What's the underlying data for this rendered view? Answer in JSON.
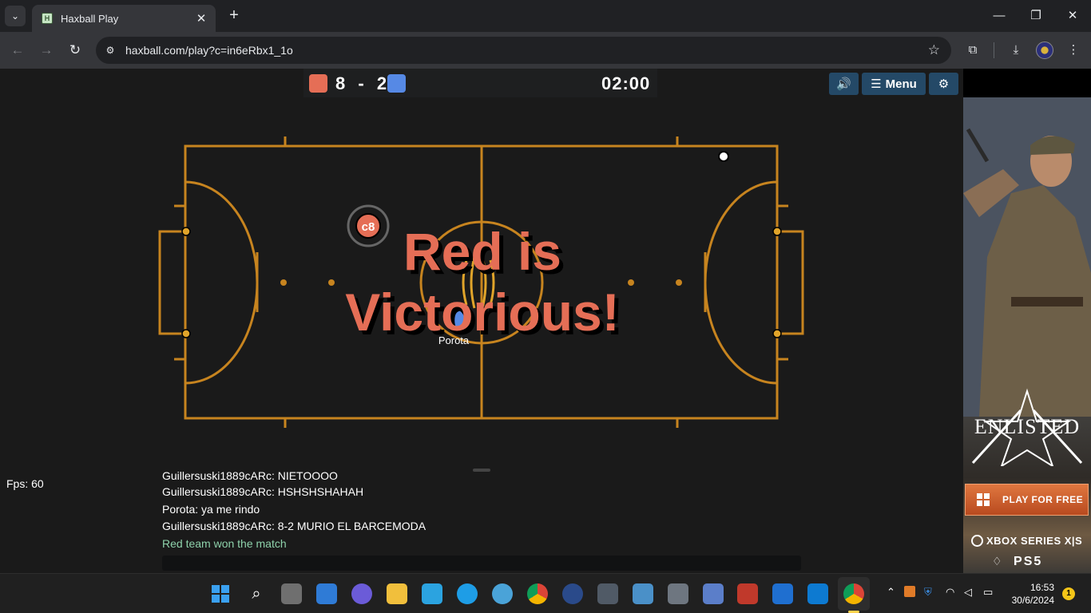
{
  "browser": {
    "tab_title": "Haxball Play",
    "favicon_letter": "H",
    "url": "haxball.com/play?c=in6eRbx1_1o"
  },
  "game": {
    "score": {
      "red": "8",
      "separator": "-",
      "blue": "2"
    },
    "timer": "02:00",
    "buttons": {
      "sound_icon": "speaker-icon",
      "menu_label": "Menu",
      "settings_icon": "gear-icon"
    },
    "victory_line1": "Red is",
    "victory_line2": "Victorious!",
    "player_avatar": "c8",
    "player_name": "Porota",
    "fps_label": "Fps: 60",
    "colors": {
      "red_team": "#e56e56",
      "blue_team": "#5689e5",
      "field_line": "#c7841f",
      "victory_text": "#e56e56"
    }
  },
  "chat": {
    "messages": [
      {
        "text": "Guillersuski1889cARc: NIETOOOO",
        "type": "user"
      },
      {
        "text": "Guillersuski1889cARc: HSHSHSHAHAH",
        "type": "user"
      },
      {
        "text": "Porota: ya me rindo",
        "type": "user"
      },
      {
        "text": "Guillersuski1889cARc: 8-2 MURIO EL BARCEMODA",
        "type": "user"
      },
      {
        "text": "Red team won the match",
        "type": "system"
      }
    ],
    "input_value": ""
  },
  "ad": {
    "brand": "ENLISTED",
    "cta": "PLAY FOR FREE",
    "platform1": "XBOX SERIES X|S",
    "platform2": "PS5"
  },
  "taskbar": {
    "time": "16:53",
    "date": "30/6/2024",
    "notification_count": "1"
  }
}
